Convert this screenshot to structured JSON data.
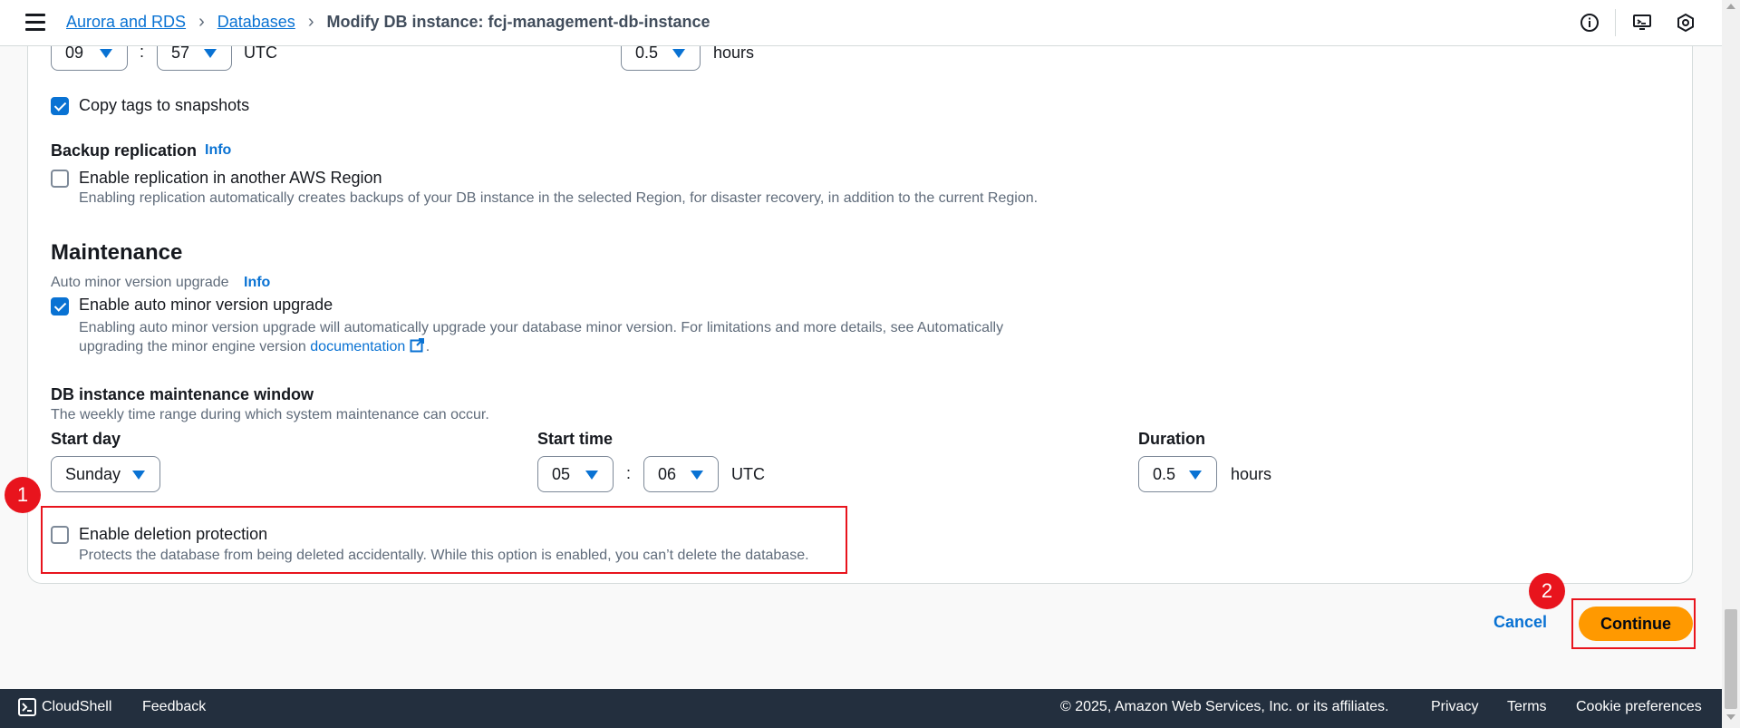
{
  "breadcrumb": {
    "item1": "Aurora and RDS",
    "item2": "Databases",
    "current": "Modify DB instance: fcj-management-db-instance"
  },
  "backup_window": {
    "hour": "09",
    "minute": "57",
    "sep": ":",
    "tz": "UTC",
    "duration": "0.5",
    "duration_unit": "hours"
  },
  "copy_tags": {
    "label": "Copy tags to snapshots",
    "checked": true
  },
  "backup_replication": {
    "heading": "Backup replication",
    "info": "Info",
    "label": "Enable replication in another AWS Region",
    "desc": "Enabling replication automatically creates backups of your DB instance in the selected Region, for disaster recovery, in addition to the current Region.",
    "checked": false
  },
  "maintenance": {
    "heading": "Maintenance",
    "auto_minor_label": "Auto minor version upgrade",
    "info": "Info",
    "auto_minor_checkbox": "Enable auto minor version upgrade",
    "auto_minor_desc1": "Enabling auto minor version upgrade will automatically upgrade your database minor version. For limitations and more details, see Automatically",
    "auto_minor_desc2": "upgrading the minor engine version",
    "doc_link": "documentation",
    "period": ".",
    "window_heading": "DB instance maintenance window",
    "window_desc": "The weekly time range during which system maintenance can occur.",
    "start_day_label": "Start day",
    "start_day": "Sunday",
    "start_time_label": "Start time",
    "start_hour": "05",
    "start_minute": "06",
    "sep": ":",
    "tz": "UTC",
    "duration_label": "Duration",
    "duration": "0.5",
    "duration_unit": "hours"
  },
  "deletion_protection": {
    "label": "Enable deletion protection",
    "desc": "Protects the database from being deleted accidentally. While this option is enabled, you can’t delete the database.",
    "checked": false
  },
  "annotations": {
    "badge1": "1",
    "badge2": "2",
    "color": "#e8141d"
  },
  "actions": {
    "cancel": "Cancel",
    "continue": "Continue"
  },
  "footer": {
    "cloudshell": "CloudShell",
    "feedback": "Feedback",
    "copyright": "© 2025, Amazon Web Services, Inc. or its affiliates.",
    "privacy": "Privacy",
    "terms": "Terms",
    "cookies": "Cookie preferences"
  },
  "colors": {
    "accent": "#0972d3",
    "primary_button": "#ff9900",
    "footer_bg": "#232f3e"
  },
  "icons": [
    "menu-icon",
    "info-circle-icon",
    "screen-share-icon",
    "settings-hexagon-icon",
    "external-link-icon",
    "cloudshell-icon"
  ]
}
